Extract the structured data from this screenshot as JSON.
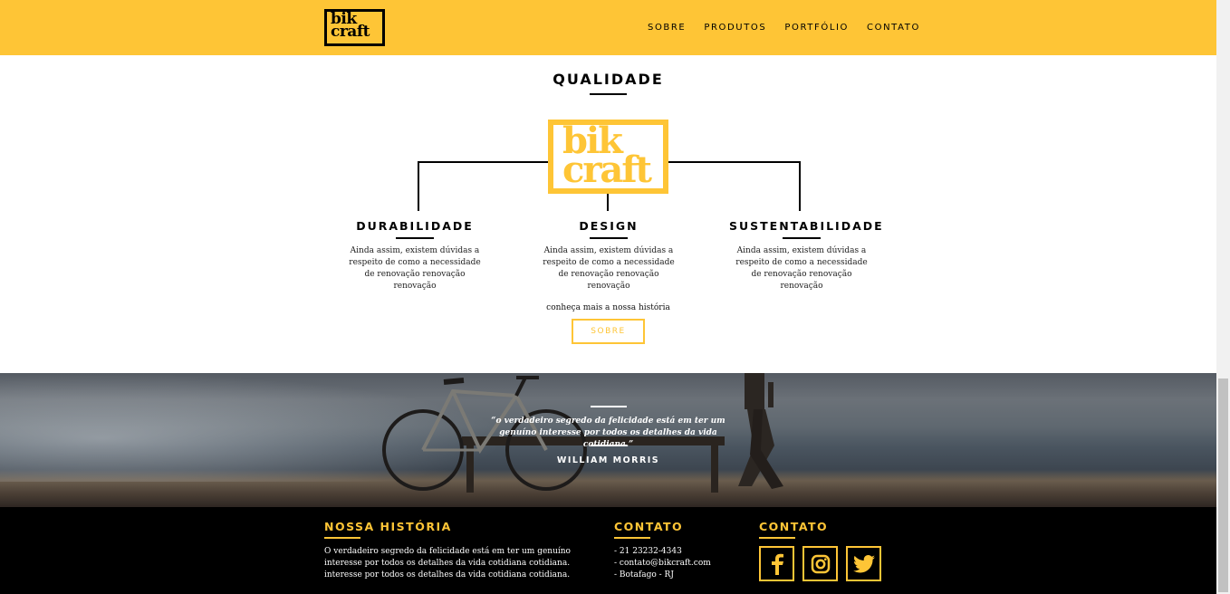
{
  "header": {
    "logo_line1": "bik",
    "logo_line2": "craft",
    "nav": [
      "SOBRE",
      "PRODUTOS",
      "PORTFÓLIO",
      "CONTATO"
    ]
  },
  "quality": {
    "title": "QUALIDADE",
    "logo_line1": "bik",
    "logo_line2": "craft",
    "features": [
      {
        "title": "DURABILIDADE",
        "text": "Ainda assim, existem dúvidas a respeito de como a necessidade de renovação renovação renovação"
      },
      {
        "title": "DESIGN",
        "text": "Ainda assim, existem dúvidas a respeito de como a necessidade de renovação renovação renovação"
      },
      {
        "title": "SUSTENTABILIDADE",
        "text": "Ainda assim, existem dúvidas a respeito de como a necessidade de renovação renovação renovação"
      }
    ],
    "history_link": "conheça mais a nossa história",
    "button_label": "SOBRE"
  },
  "quote": {
    "text": "“o verdadeiro segredo da felicidade está em ter um genuíno interesse por todos os detalhes da vida cotidiana.”",
    "author": "WILLIAM MORRIS"
  },
  "footer": {
    "history_title": "NOSSA HISTÓRIA",
    "history_lines": [
      "O verdadeiro segredo da felicidade está em ter um genuíno",
      "interesse por todos os detalhes da vida cotidiana cotidiana.",
      "interesse por todos os detalhes da vida cotidiana cotidiana."
    ],
    "contact_title": "CONTATO",
    "contact_lines": [
      "- 21 23232-4343",
      "- contato@bikcraft.com",
      "- Botafago - RJ"
    ],
    "social_title": "CONTATO",
    "social_icons": [
      "facebook-icon",
      "instagram-icon",
      "twitter-icon"
    ]
  },
  "colors": {
    "accent": "#FEC536",
    "dark": "#000000"
  }
}
